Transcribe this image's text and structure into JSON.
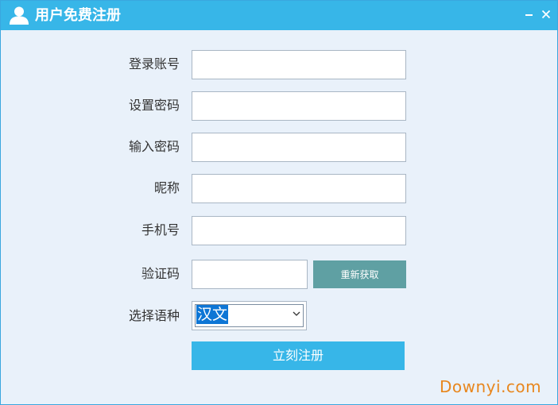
{
  "window": {
    "title": "用户免费注册",
    "controls": [
      "minimize-icon",
      "close-icon"
    ],
    "colors": {
      "titlebar": "#37b6e8",
      "background": "#e9f1fa",
      "refresh_button": "#5fa0a3",
      "submit_button": "#37b6e8"
    }
  },
  "form": {
    "account_label": "登录账号",
    "account_value": "",
    "password_label": "设置密码",
    "password_value": "",
    "confirm_label": "输入密码",
    "confirm_value": "",
    "nickname_label": "昵称",
    "nickname_value": "",
    "phone_label": "手机号",
    "phone_value": "",
    "captcha_label": "验证码",
    "captcha_value": "",
    "refresh_label": "重新获取",
    "language_label": "选择语种",
    "language_selected": "汉文",
    "submit_label": "立刻注册"
  },
  "watermark": "Downyi.com"
}
